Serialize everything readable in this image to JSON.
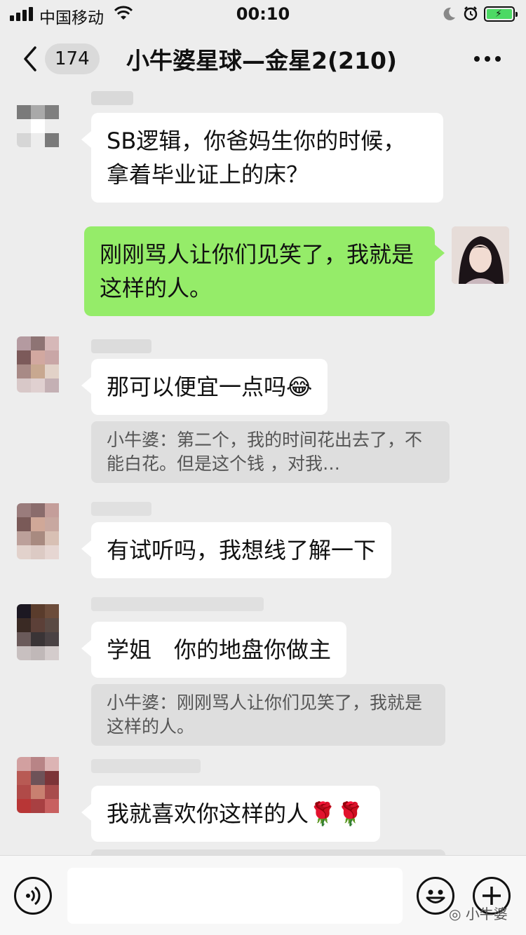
{
  "status_bar": {
    "carrier": "中国移动",
    "time": "00:10",
    "signal_bars": 4,
    "battery_charging": true,
    "battery_color": "#4cd964"
  },
  "nav": {
    "back_icon": "chevron-left-icon",
    "unread_count": "174",
    "title": "小牛婆星球—金星2(210)",
    "more_icon": "more-dots-icon"
  },
  "messages": [
    {
      "from": "other",
      "text": "SB逻辑，你爸妈生你的时候，拿着毕业证上的床？"
    },
    {
      "from": "me",
      "text": "刚刚骂人让你们见笑了，我就是这样的人。"
    },
    {
      "from": "other",
      "text": "那可以便宜一点吗😂",
      "quote": "小牛婆：第二个，我的时间花出去了，不能白花。但是这个钱 ，对我…"
    },
    {
      "from": "other",
      "text": "有试听吗，我想线了解一下"
    },
    {
      "from": "other",
      "text": "学姐　你的地盘你做主",
      "quote": "小牛婆：刚刚骂人让你们见笑了，我就是这样的人。"
    },
    {
      "from": "other",
      "text": "我就喜欢你这样的人🌹🌹"
    }
  ],
  "input_bar": {
    "voice_icon": "voice-icon",
    "emoji_icon": "emoji-icon",
    "plus_icon": "plus-icon"
  },
  "colors": {
    "background": "#ededed",
    "my_bubble": "#95ec69",
    "other_bubble": "#ffffff",
    "quote_bg": "#dedede"
  },
  "watermark": "小牛婆"
}
